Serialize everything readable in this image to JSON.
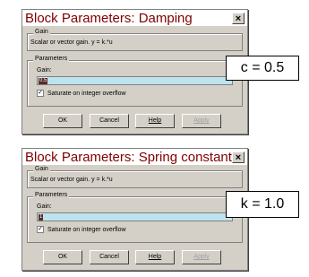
{
  "dialogs": [
    {
      "title": "Block Parameters: Damping",
      "close_glyph": "×",
      "block_label": "Gain",
      "description": "Scalar or vector gain. y = k.*u",
      "params_label": "Parameters",
      "gain_label": "Gain:",
      "gain_value": "0.5",
      "checkbox_label": "Saturate on integer overflow",
      "checkbox_checked": true,
      "buttons": {
        "ok": "OK",
        "cancel": "Cancel",
        "help": "Help",
        "apply": "Apply"
      },
      "callout": "c = 0.5"
    },
    {
      "title": "Block Parameters: Spring constant",
      "close_glyph": "×",
      "block_label": "Gain",
      "description": "Scalar or vector gain. y = k.*u",
      "params_label": "Parameters",
      "gain_label": "Gain:",
      "gain_value": "1",
      "checkbox_label": "Saturate on integer overflow",
      "checkbox_checked": true,
      "buttons": {
        "ok": "OK",
        "cancel": "Cancel",
        "help": "Help",
        "apply": "Apply"
      },
      "callout": "k = 1.0"
    }
  ],
  "colors": {
    "title_text": "#800000",
    "dialog_bg": "#d4d0c8",
    "input_bg": "#bde4ee",
    "selection_bg": "#5a2a2a"
  },
  "check_glyph": "✓"
}
